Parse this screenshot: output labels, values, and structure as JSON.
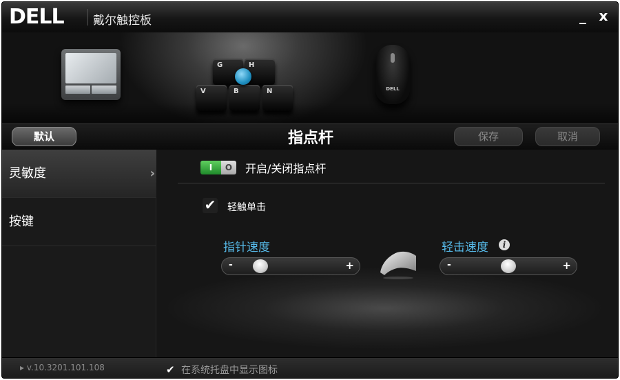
{
  "window": {
    "logo": "DELL",
    "title": "戴尔触控板",
    "minimize_label": "_",
    "close_label": "x"
  },
  "devices": {
    "trackpoint_keys": [
      "G",
      "H",
      "V",
      "B",
      "N"
    ],
    "mouse_brand": "DELL"
  },
  "header": {
    "default_label": "默认",
    "title": "指点杆",
    "save_label": "保存",
    "cancel_label": "取消"
  },
  "sidebar": {
    "items": [
      {
        "label": "灵敏度",
        "active": true,
        "arrow": "›"
      },
      {
        "label": "按键",
        "active": false
      }
    ]
  },
  "main": {
    "toggle": {
      "on_label": "I",
      "off_label": "O",
      "label": "开启/关闭指点杆",
      "state": "on"
    },
    "tap_click": {
      "checked": true,
      "check_glyph": "✔",
      "label": "轻触单击"
    },
    "pointer_speed": {
      "label": "指针速度",
      "minus": "-",
      "plus": "+",
      "value": 0.15
    },
    "tap_speed": {
      "label": "轻击速度",
      "info_glyph": "i",
      "minus": "-",
      "plus": "+",
      "value": 0.5
    }
  },
  "footer": {
    "version": "▸ v.10.3201.101.108",
    "tray_checked": true,
    "tray_check_glyph": "✔",
    "tray_label": "在系统托盘中显示图标"
  }
}
